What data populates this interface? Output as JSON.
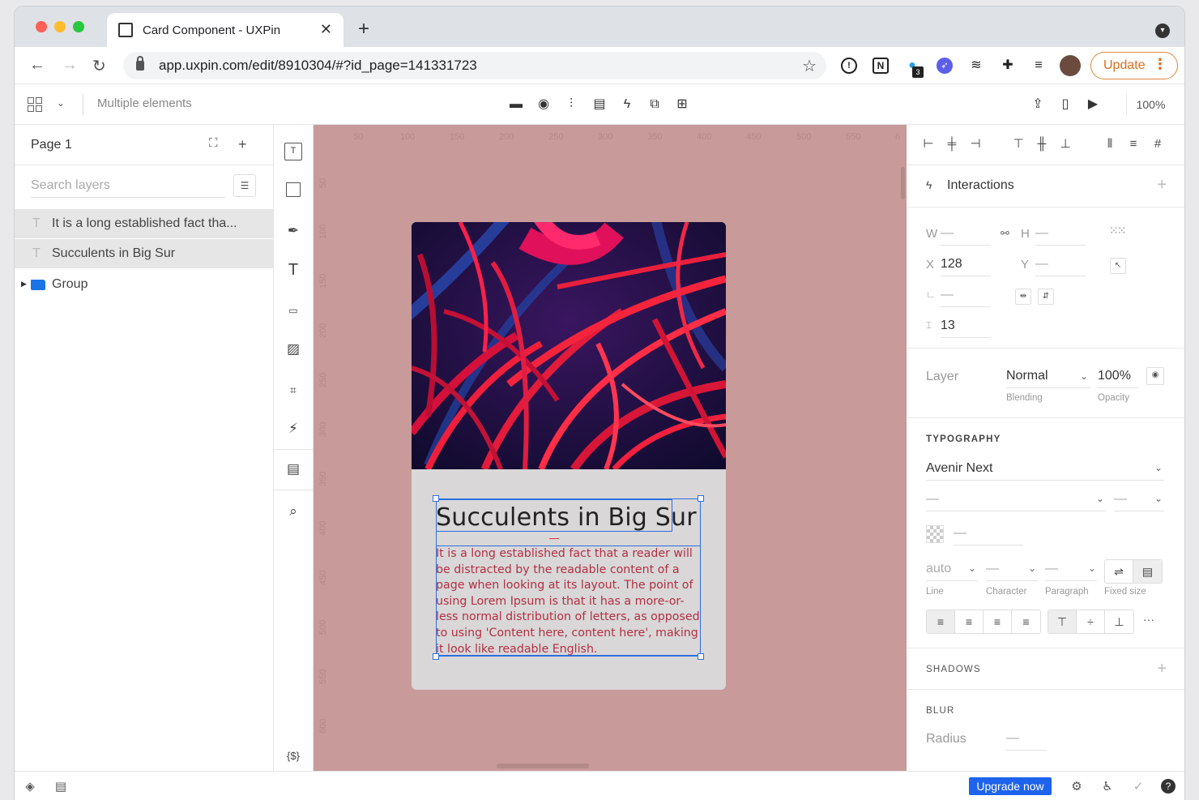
{
  "browser": {
    "tab_title": "Card Component - UXPin",
    "tab_close": "✕",
    "new_tab": "+",
    "url": "app.uxpin.com/edit/8910304/#?id_page=141331723",
    "badge_count": "3",
    "update_label": "Update"
  },
  "toolbar": {
    "selection_label": "Multiple elements",
    "zoom": "100%"
  },
  "left_panel": {
    "page_name": "Page 1",
    "search_placeholder": "Search layers",
    "layers": [
      {
        "name": "It is a long established fact tha..."
      },
      {
        "name": "Succulents in Big Sur"
      },
      {
        "name": "Group"
      }
    ]
  },
  "canvas": {
    "ruler_x": [
      "50",
      "100",
      "150",
      "200",
      "250",
      "300",
      "350",
      "400",
      "450",
      "500",
      "550",
      "6"
    ],
    "ruler_y": [
      "50",
      "100",
      "150",
      "200",
      "250",
      "300",
      "350",
      "400",
      "450",
      "500",
      "550",
      "600"
    ],
    "card": {
      "title": "Succulents in Big Sur",
      "body": "It is a long established fact that a reader will be distracted by the readable content of a page when looking at its layout. The point of using Lorem Ipsum is that it has a more-or-less normal distribution of letters, as opposed to using 'Content here, content here', making it look like readable English."
    }
  },
  "right_panel": {
    "interactions_label": "Interactions",
    "w_label": "W",
    "w_value": "—",
    "h_label": "H",
    "h_value": "—",
    "x_label": "X",
    "x_value": "128",
    "y_label": "Y",
    "y_value": "—",
    "rotation_value": "—",
    "spacing_value": "13",
    "layer_label": "Layer",
    "blending_value": "Normal",
    "blending_caption": "Blending",
    "opacity_value": "100%",
    "opacity_caption": "Opacity",
    "typography_title": "TYPOGRAPHY",
    "font_family": "Avenir Next",
    "font_weight": "—",
    "font_size": "—",
    "color_value": "—",
    "line_value": "auto",
    "line_caption": "Line",
    "character_value": "—",
    "character_caption": "Character",
    "paragraph_value": "—",
    "paragraph_caption": "Paragraph",
    "fixed_caption": "Fixed size",
    "more": "···",
    "shadows_title": "SHADOWS",
    "blur_title": "BLUR",
    "radius_label": "Radius",
    "radius_value": "—"
  },
  "statusbar": {
    "upgrade_label": "Upgrade now"
  },
  "colors": {
    "canvas_bg": "#c99a9a",
    "card_bg": "#d9d7d7",
    "body_text": "#b22f45",
    "selection": "#2f6fe0",
    "update_accent": "#d96d1b",
    "upgrade_bg": "#1d63ed"
  }
}
